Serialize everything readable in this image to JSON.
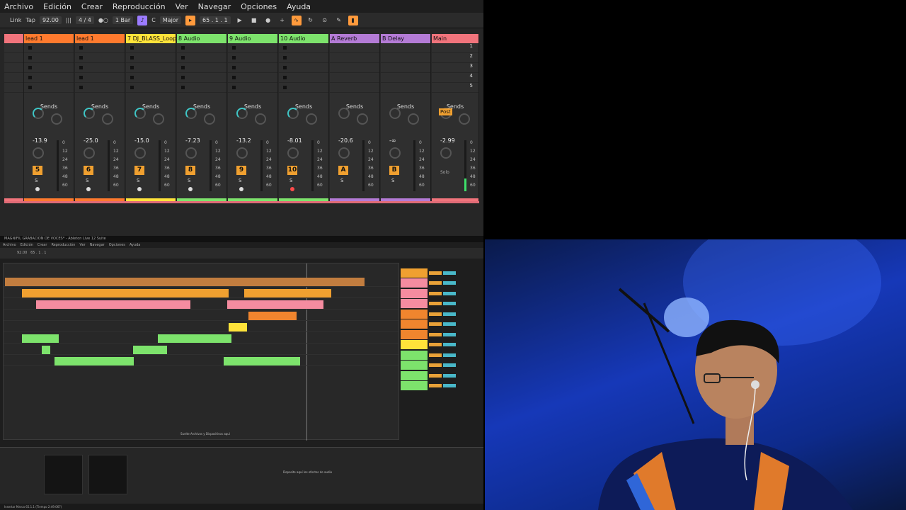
{
  "menu": {
    "items": [
      "Archivo",
      "Edición",
      "Crear",
      "Reproducción",
      "Ver",
      "Navegar",
      "Opciones",
      "Ayuda"
    ]
  },
  "transport": {
    "link": "Link",
    "tap": "Tap",
    "tempo": "92.00",
    "signature": "4 / 4",
    "quantize": "1 Bar",
    "key": "C",
    "scale": "Major",
    "position": "65 .  1 .  1"
  },
  "tracks": [
    {
      "name": "",
      "num": "",
      "color": "#f1747c",
      "vol": "",
      "head_color": "#f1747c"
    },
    {
      "name": "lead 1",
      "num": "5",
      "color": "#ff7a2e",
      "vol": "-13.9",
      "head_color": "#ff7a2e"
    },
    {
      "name": "lead 1",
      "num": "6",
      "color": "#ff7a2e",
      "vol": "-25.0",
      "head_color": "#ff7a2e"
    },
    {
      "name": "7 DJ_BLASS_Loop",
      "num": "7",
      "color": "#ffe33a",
      "vol": "-15.0",
      "head_color": "#ffe33a"
    },
    {
      "name": "8 Audio",
      "num": "8",
      "color": "#7de36c",
      "vol": "-7.23",
      "head_color": "#7de36c"
    },
    {
      "name": "9 Audio",
      "num": "9",
      "color": "#7de36c",
      "vol": "-13.2",
      "head_color": "#7de36c"
    },
    {
      "name": "10 Audio",
      "num": "10",
      "color": "#7de36c",
      "vol": "-8.01",
      "head_color": "#7de36c"
    },
    {
      "name": "A Reverb",
      "num": "A",
      "color": "#b47bd6",
      "vol": "-20.6",
      "head_color": "#b47bd6"
    },
    {
      "name": "B Delay",
      "num": "B",
      "color": "#b47bd6",
      "vol": "-∞",
      "head_color": "#b47bd6"
    },
    {
      "name": "Main",
      "num": "",
      "color": "#f1747c",
      "vol": "-2.99",
      "head_color": "#f1747c"
    }
  ],
  "labels": {
    "sends": "Sends",
    "post": "Post",
    "solo": "Solo",
    "s": "S",
    "scale_marks": [
      "0",
      "12",
      "24",
      "36",
      "48",
      "60"
    ],
    "scene_numbers": [
      "1",
      "2",
      "3",
      "4",
      "5"
    ]
  },
  "daw": {
    "title": "MAGNIFIL GRABACION DE VOCES* - Ableton Live 12 Suite",
    "menu": [
      "Archivo",
      "Edición",
      "Crear",
      "Reproducción",
      "Ver",
      "Navegar",
      "Opciones",
      "Ayuda"
    ],
    "drop_hint": "Suelte Archivos y Dispositivos aquí",
    "device_hint": "Deposite aquí los efectos de audio",
    "status": "Insertar Marca 65.1.1 (Tiempo 2:49:067)"
  }
}
